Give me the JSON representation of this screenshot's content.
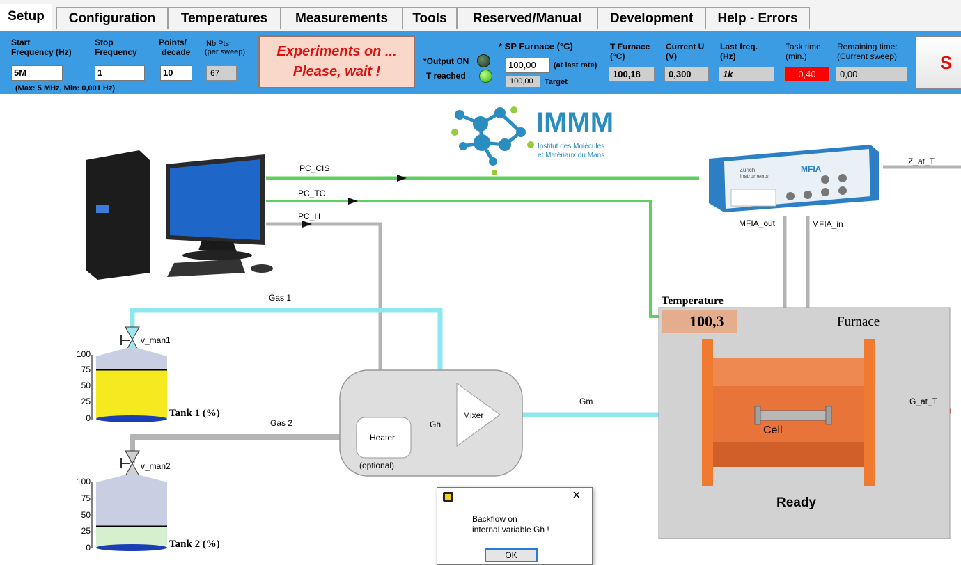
{
  "tabs": [
    "Setup",
    "Configuration",
    "Temperatures",
    "Measurements",
    "Tools",
    "Reserved/Manual",
    "Development",
    "Help - Errors"
  ],
  "controls": {
    "start_freq": {
      "label1": "Start",
      "label2": "Frequency (Hz)",
      "value": "5M",
      "note": "(Max: 5 MHz, Min: 0,001 Hz)"
    },
    "stop_freq": {
      "label1": "Stop",
      "label2": "Frequency",
      "value": "1"
    },
    "points": {
      "label1": "Points/",
      "label2": "decade",
      "value": "10"
    },
    "nbpts": {
      "label1": "Nb Pts",
      "label2": "(per sweep)",
      "value": "67"
    },
    "banner": {
      "line1": "Experiments on ...",
      "line2": "Please, wait !"
    },
    "output_on": "*Output ON",
    "t_reached": "T reached",
    "sp_furnace": {
      "label": "* SP Furnace (°C)",
      "value": "100,00",
      "rate": "(at last rate)",
      "target_value": "100,00",
      "target_label": "Target"
    },
    "t_furnace": {
      "label1": "T Furnace",
      "label2": "(°C)",
      "value": "100,18"
    },
    "current_u": {
      "label1": "Current U",
      "label2": "(V)",
      "value": "0,300"
    },
    "last_freq": {
      "label1": "Last freq.",
      "label2": "(Hz)",
      "value": "1k"
    },
    "task_time": {
      "label1": "Task time",
      "label2": "(min.)",
      "value": "0,40"
    },
    "remaining": {
      "label1": "Remaining time:",
      "label2": "(Current sweep)",
      "value": "0,00"
    },
    "stop_button": "S"
  },
  "logo": {
    "title": "IMMM",
    "sub1": "Institut des Molécules",
    "sub2": "et Matériaux du Mans"
  },
  "wires": {
    "pc_cis": "PC_CIS",
    "pc_tc": "PC_TC",
    "pc_h": "PC_H",
    "z_at_t": "Z_at_T",
    "mfia_out": "MFIA_out",
    "mfia_in": "MFIA_in",
    "gas1": "Gas 1",
    "gas2": "Gas 2",
    "gh": "Gh",
    "gm": "Gm",
    "g_at_t": "G_at_T"
  },
  "valves": {
    "v1": "v_man1",
    "v2": "v_man2"
  },
  "tanks": {
    "tank1": {
      "label": "Tank 1 (%)",
      "level_percent": 75,
      "color": "#f5ea1f"
    },
    "tank2": {
      "label": "Tank 2 (%)",
      "level_percent": 30,
      "color": "#d6efcf"
    },
    "ticks": [
      "100",
      "75",
      "50",
      "25",
      "0"
    ]
  },
  "heater": {
    "label": "Heater",
    "optional": "(optional)"
  },
  "mixer": {
    "label": "Mixer"
  },
  "furnace": {
    "title": "Furnace",
    "temp_label": "Temperature",
    "temp_value": "100,3",
    "cell": "Cell",
    "status": "Ready"
  },
  "mfia": {
    "brand": "MFIA",
    "maker": "Zurich Instruments"
  },
  "dialog": {
    "message1": "Backflow on",
    "message2": "internal variable Gh !",
    "ok": "OK",
    "close": "×"
  },
  "colors": {
    "ctrl_bg": "#3b9ce3",
    "banner_text": "#e01010",
    "task_time_bg": "#ff0000",
    "pipe_green": "#5fd05f",
    "pipe_cyan": "#8fe6ef",
    "pipe_gray": "#b4b4b4",
    "furnace_orange": "#f07a30",
    "outlet_red": "#e02020"
  }
}
